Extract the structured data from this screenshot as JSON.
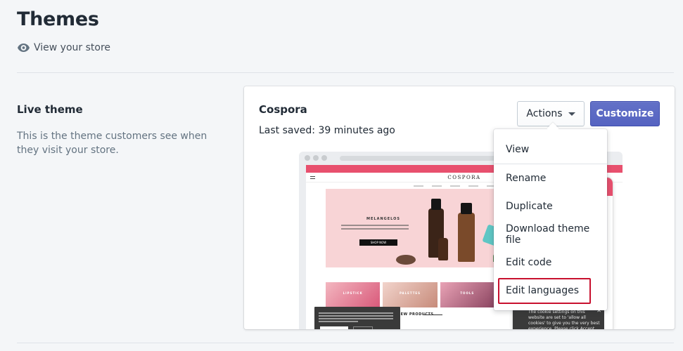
{
  "header": {
    "title": "Themes",
    "view_store_label": "View your store",
    "view_store_icon": "eye-icon"
  },
  "live_section": {
    "title": "Live theme",
    "description": "This is the theme customers see when they visit your store."
  },
  "theme_card": {
    "name": "Cospora",
    "last_saved": "Last saved: 39 minutes ago",
    "actions_label": "Actions",
    "customize_label": "Customize",
    "preview": {
      "site_logo": "COSPORA",
      "hero_title": "MELANGELOS",
      "hero_button": "SHOP NOW",
      "categories": [
        "LIPSTICK",
        "PALETTES",
        "TOOLS"
      ],
      "new_products": "NEW PRODUCTS",
      "mobile_cookie_text": "The cookie settings on this website are set to 'allow all cookies' to give you the very best experience. Please click Accept Cookies to"
    }
  },
  "actions_menu": {
    "items": [
      {
        "label": "View"
      },
      {
        "label": "Rename"
      },
      {
        "label": "Duplicate"
      },
      {
        "label": "Download theme file"
      },
      {
        "label": "Edit code"
      },
      {
        "label": "Edit languages"
      }
    ],
    "highlighted_item": "Edit languages"
  },
  "colors": {
    "primary_button": "#5c6ac4",
    "highlight_border": "#c8102e",
    "background": "#f4f6f8",
    "preview_accent": "#e8506e"
  }
}
